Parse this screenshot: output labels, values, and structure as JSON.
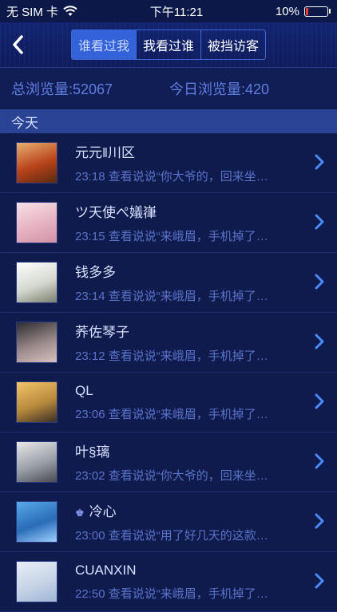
{
  "status": {
    "carrier": "无 SIM 卡",
    "time": "下午11:21",
    "battery": "10%"
  },
  "nav": {
    "tabs": [
      "谁看过我",
      "我看过谁",
      "被挡访客"
    ],
    "active_tab": 0
  },
  "stats": {
    "total": "总浏览量:52067",
    "today": "今日浏览量:420"
  },
  "section": {
    "title": "今天"
  },
  "items": [
    {
      "name": "元元‖川区",
      "detail": "23:18 查看说说“你大爷的，回来坐…",
      "avatar_colors": [
        "#e8b070",
        "#b8431a",
        "#5a2a10"
      ]
    },
    {
      "name": "ツ天使ぺ嬟嵂",
      "detail": "23:15 查看说说“来峨眉，手机掉了…",
      "avatar_colors": [
        "#f6e2e6",
        "#e6b2c2",
        "#cf93a6"
      ]
    },
    {
      "name": "钱多多",
      "detail": "23:14 查看说说“来峨眉，手机掉了…",
      "avatar_colors": [
        "#ffffff",
        "#d5d8cf",
        "#7a7f6f"
      ]
    },
    {
      "name": "荞佐琴子",
      "detail": "23:12 查看说说“来峨眉，手机掉了…",
      "avatar_colors": [
        "#2b2b30",
        "#9a8a8a",
        "#d8c2bf"
      ]
    },
    {
      "name": "QL",
      "detail": "23:06 查看说说“来峨眉，手机掉了…",
      "avatar_colors": [
        "#f4c46a",
        "#b88a3c",
        "#3a2f28"
      ]
    },
    {
      "name": "叶§璃",
      "detail": "23:02 查看说说“你大爷的，回来坐…",
      "avatar_colors": [
        "#e8e8e8",
        "#9aa0a8",
        "#4a4a52"
      ]
    },
    {
      "name": "冷心",
      "detail": "23:00 查看说说“用了好几天的这款…",
      "avatar_colors": [
        "#58a8e8",
        "#2a6cb8",
        "#9fd0ff"
      ],
      "crown": true
    },
    {
      "name": "CUANXIN",
      "detail": "22:50 查看说说“来峨眉，手机掉了…",
      "avatar_colors": [
        "#e8eef6",
        "#c7d3e6",
        "#9eb6d6"
      ]
    }
  ]
}
